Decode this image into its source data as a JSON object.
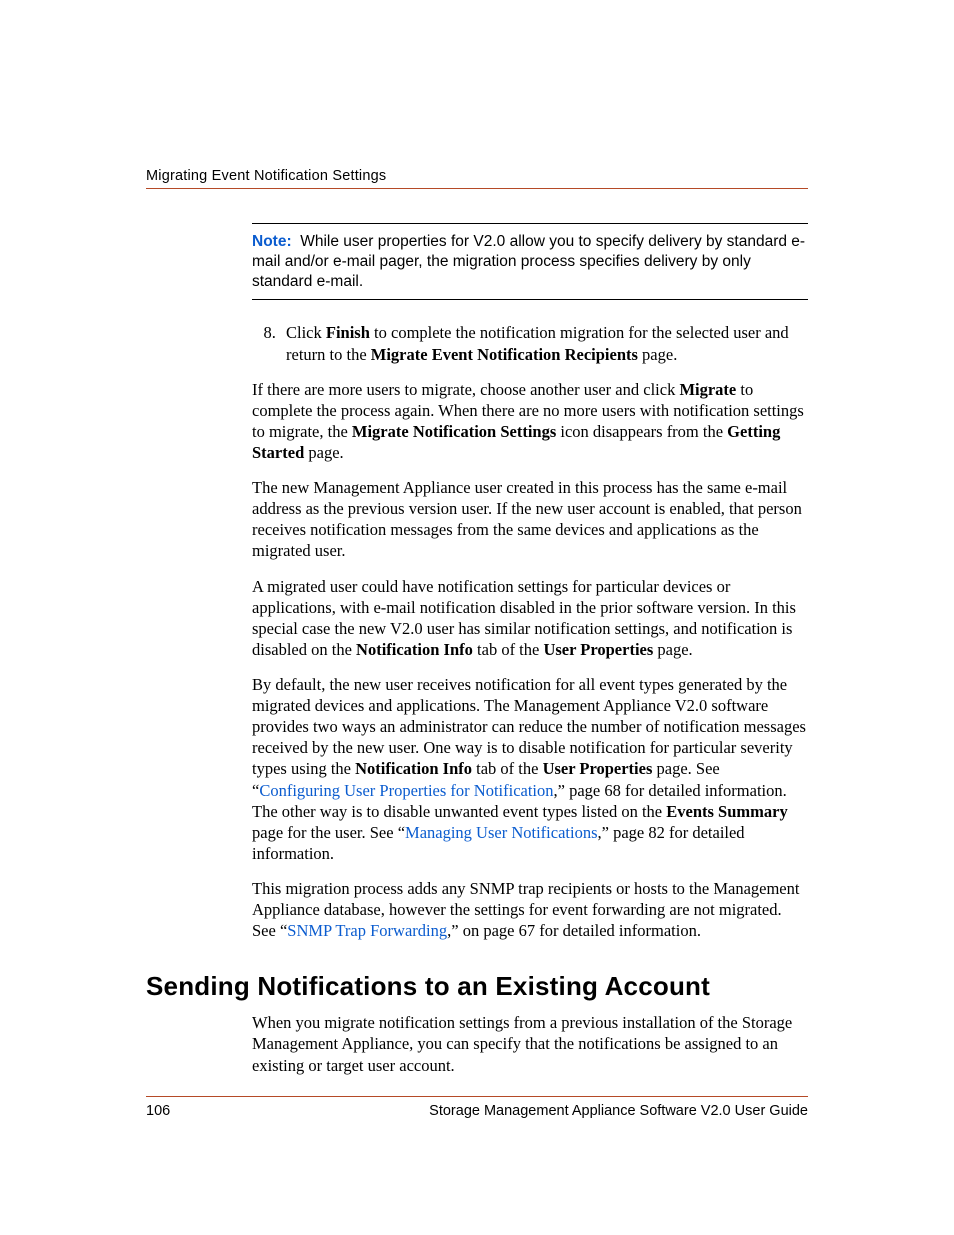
{
  "header": {
    "running_title": "Migrating Event Notification Settings"
  },
  "note": {
    "label": "Note:",
    "text": "While user properties for V2.0 allow you to specify delivery by standard e-mail and/or e-mail pager, the migration process specifies delivery by only standard e-mail."
  },
  "step8": {
    "number": "8.",
    "pre": "Click ",
    "bold1": "Finish",
    "mid": " to complete the notification migration for the selected user and return to the ",
    "bold2": "Migrate Event Notification Recipients",
    "post": " page."
  },
  "p1": {
    "a": "If there are more users to migrate, choose another user and click ",
    "b": "Migrate",
    "c": " to complete the process again. When there are no more users with notification settings to migrate, the ",
    "d": "Migrate Notification Settings",
    "e": " icon disappears from the ",
    "f": "Getting Started",
    "g": " page."
  },
  "p2": "The new Management Appliance user created in this process has the same e-mail address as the previous version user. If the new user account is enabled, that person receives notification messages from the same devices and applications as the migrated user.",
  "p3": {
    "a": "A migrated user could have notification settings for particular devices or applications, with e-mail notification disabled in the prior software version. In this special case the new V2.0 user has similar notification settings, and notification is disabled on the ",
    "b": "Notification Info",
    "c": " tab of the ",
    "d": "User Properties",
    "e": " page."
  },
  "p4": {
    "a": "By default, the new user receives notification for all event types generated by the migrated devices and applications. The Management Appliance V2.0 software provides two ways an administrator can reduce the number of notification messages received by the new user. One way is to disable notification for particular severity types using the ",
    "b": "Notification Info",
    "c": " tab of the ",
    "d": "User Properties",
    "e": " page. See “",
    "link1": "Configuring User Properties for Notification",
    "f": ",” page 68 for detailed information. The other way is to disable unwanted event types listed on the ",
    "g": "Events Summary",
    "h": " page for the user. See “",
    "link2": "Managing User Notifications",
    "i": ",” page 82 for detailed information."
  },
  "p5": {
    "a": "This migration process adds any SNMP trap recipients or hosts to the Management Appliance database, however the settings for event forwarding are not migrated. See “",
    "link1": "SNMP Trap Forwarding",
    "b": ",” on page 67 for detailed information."
  },
  "section_heading": "Sending Notifications to an Existing Account",
  "p6": "When you migrate notification settings from a previous installation of the Storage Management Appliance, you can specify that the notifications be assigned to an existing or target user account.",
  "footer": {
    "page_number": "106",
    "doc_title": "Storage Management Appliance Software V2.0 User Guide"
  }
}
